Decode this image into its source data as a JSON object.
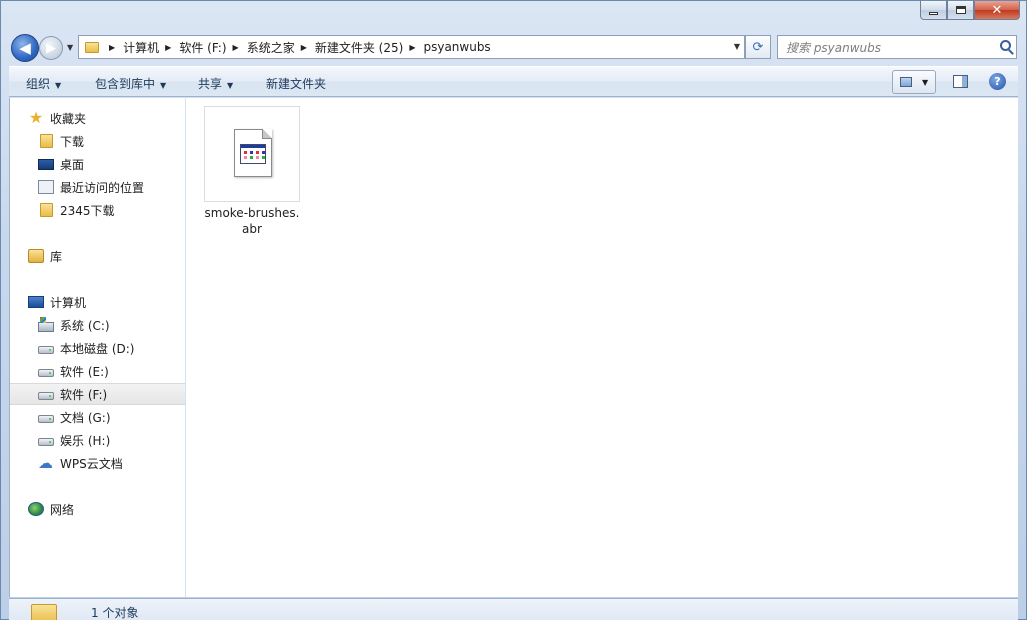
{
  "window": {
    "close_glyph": "✕"
  },
  "navigation": {
    "back_glyph": "◀",
    "forward_glyph": "▶",
    "breadcrumbs": [
      "计算机",
      "软件 (F:)",
      "系统之家",
      "新建文件夹 (25)",
      "psyanwubs"
    ],
    "refresh_glyph": "⟳",
    "search_placeholder": "搜索 psyanwubs"
  },
  "toolbar": {
    "organize": "组织",
    "include_in_library": "包含到库中",
    "share": "共享",
    "new_folder": "新建文件夹",
    "help_glyph": "?"
  },
  "sidebar": {
    "favorites": "收藏夹",
    "downloads": "下载",
    "desktop": "桌面",
    "recent_places": "最近访问的位置",
    "folder_2345": "2345下载",
    "libraries": "库",
    "computer": "计算机",
    "drive_c": "系统 (C:)",
    "drive_d": "本地磁盘 (D:)",
    "drive_e": "软件 (E:)",
    "drive_f": "软件 (F:)",
    "drive_g": "文档 (G:)",
    "drive_h": "娱乐 (H:)",
    "wps_cloud": "WPS云文档",
    "network": "网络"
  },
  "files": [
    {
      "name": "smoke-brushes.abr",
      "icon": "document-icon"
    }
  ],
  "status": {
    "item_count": "1 个对象"
  },
  "colors": {
    "accent_blue": "#1e395b",
    "selection_gray": "#e6e6e6",
    "folder_yellow": "#e9bd47"
  }
}
